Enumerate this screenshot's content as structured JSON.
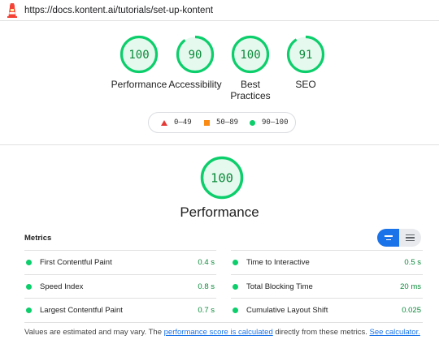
{
  "url": "https://docs.kontent.ai/tutorials/set-up-kontent",
  "colors": {
    "pass": "#0cce6b",
    "pass_text": "#0a8a3a",
    "pass_bg": "#e6f9ee",
    "fail": "#e53935",
    "average": "#fa8c16",
    "accent": "#1a73e8"
  },
  "gauges": [
    {
      "label": "Performance",
      "score": "100",
      "fraction": 1.0
    },
    {
      "label": "Accessibility",
      "score": "90",
      "fraction": 0.9
    },
    {
      "label": "Best\nPractices",
      "score": "100",
      "fraction": 1.0
    },
    {
      "label": "SEO",
      "score": "91",
      "fraction": 0.91
    }
  ],
  "legend": {
    "fail": "0–49",
    "average": "50–89",
    "pass": "90–100"
  },
  "section": {
    "score": "100",
    "score_fraction": 1.0,
    "title": "Performance"
  },
  "metrics_header": "Metrics",
  "metrics": [
    {
      "name": "First Contentful Paint",
      "value": "0.4 s"
    },
    {
      "name": "Time to Interactive",
      "value": "0.5 s"
    },
    {
      "name": "Speed Index",
      "value": "0.8 s"
    },
    {
      "name": "Total Blocking Time",
      "value": "20 ms"
    },
    {
      "name": "Largest Contentful Paint",
      "value": "0.7 s"
    },
    {
      "name": "Cumulative Layout Shift",
      "value": "0.025"
    }
  ],
  "footnote": {
    "text1": "Values are estimated and may vary. The ",
    "link1": "performance score is calculated",
    "text2": " directly from these metrics. ",
    "link2": "See calculator."
  }
}
